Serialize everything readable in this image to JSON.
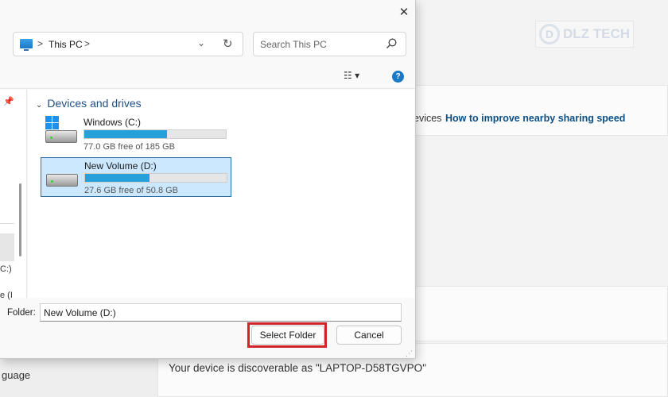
{
  "background": {
    "link_prefix": "evices",
    "link_text": "How to improve nearby sharing speed",
    "discoverable_text": "Your device is discoverable as \"LAPTOP-D58TGVPO\"",
    "sidebar_fragment": "guage",
    "logo_text": "DLZ TECH",
    "logo_mark": "D"
  },
  "dialog": {
    "close_glyph": "✕",
    "address": {
      "separator": ">",
      "crumb": "This PC",
      "crumb_separator": ">",
      "dropdown_glyph": "⌄",
      "refresh_glyph": "↻"
    },
    "search": {
      "placeholder": "Search This PC"
    },
    "toolbar": {
      "view_glyph": "☷ ▾",
      "help_glyph": "?"
    },
    "navpane": {
      "pin_glyph": "📌",
      "fragment_1": "C:)",
      "fragment_2": "e (I"
    },
    "group": {
      "chevron": "⌄",
      "title": "Devices and drives"
    },
    "drives": [
      {
        "name": "Windows (C:)",
        "free_text": "77.0 GB free of 185 GB",
        "used_fraction": 0.584,
        "selected": false
      },
      {
        "name": "New Volume (D:)",
        "free_text": "27.6 GB free of 50.8 GB",
        "used_fraction": 0.457,
        "selected": true
      }
    ],
    "folder": {
      "label": "Folder:",
      "value": "New Volume (D:)"
    },
    "buttons": {
      "select": "Select Folder",
      "cancel": "Cancel"
    },
    "grip_glyph": "⋰"
  },
  "colors": {
    "accent": "#26a0da",
    "highlight": "#d2232a",
    "selection": "#cce8ff"
  }
}
